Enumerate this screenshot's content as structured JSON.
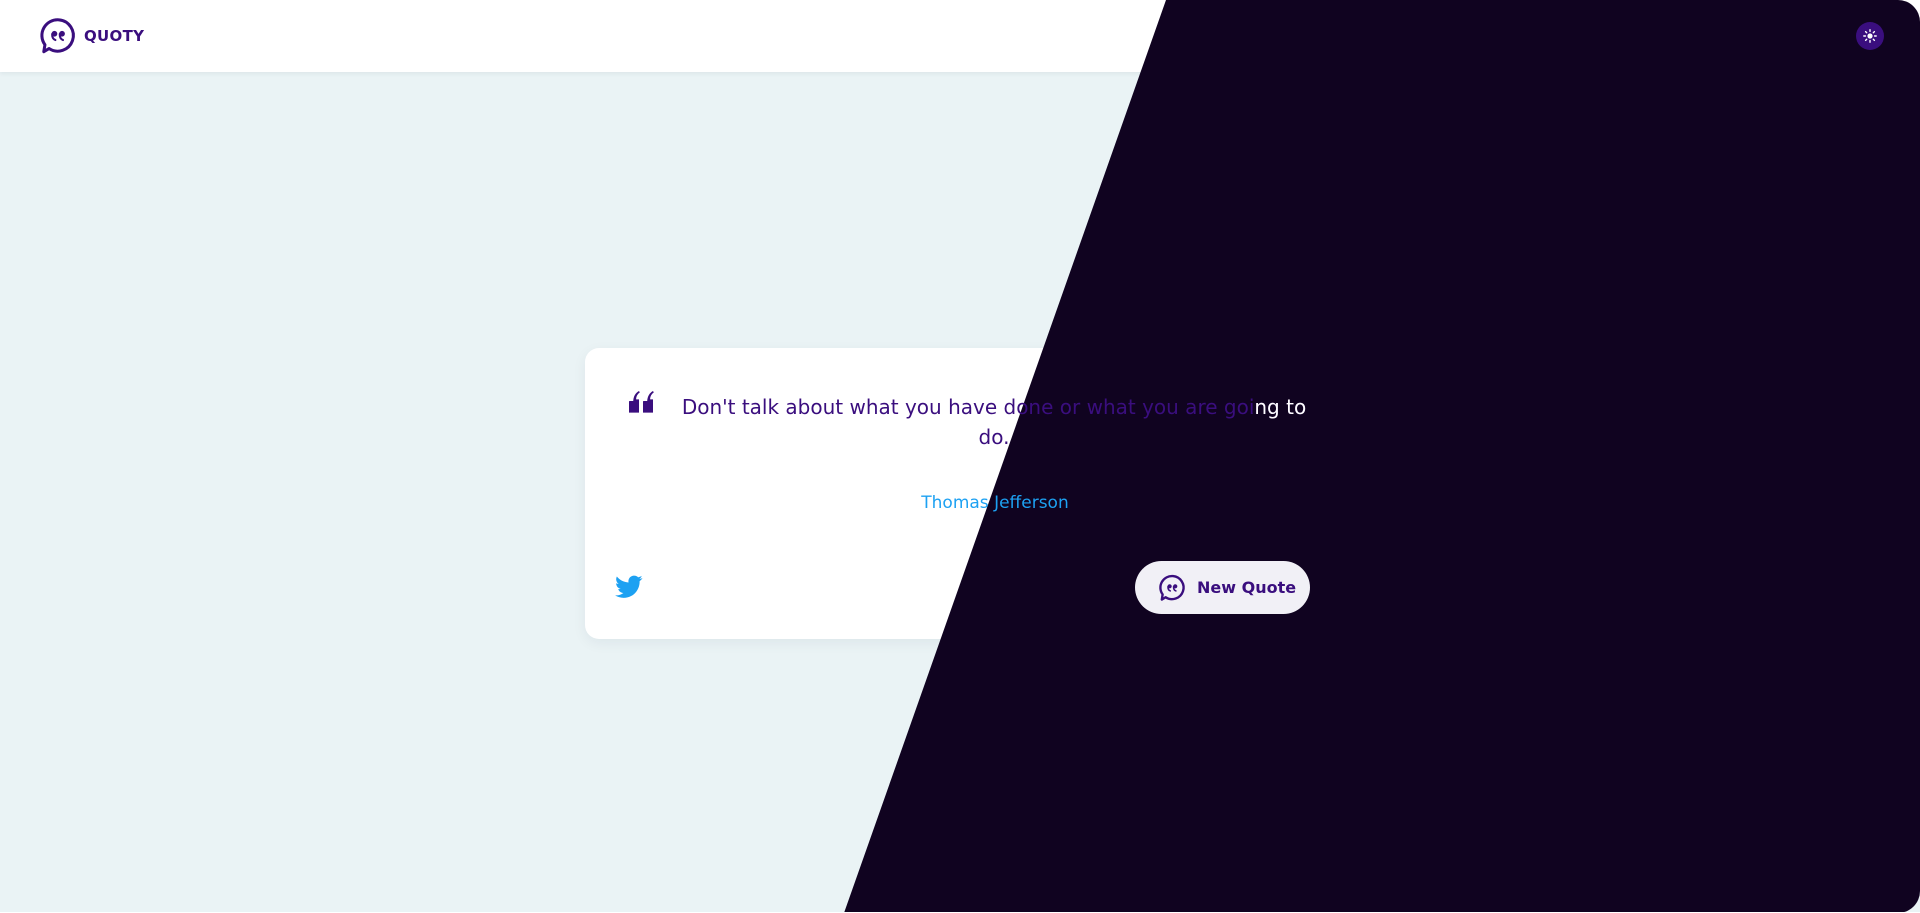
{
  "app": {
    "logo_icon": "chat-bubble-quote-icon",
    "logo_text": "QUOTY"
  },
  "header": {
    "theme_toggle_icon": "sun-icon"
  },
  "quote": {
    "quote_icon": "quote-mark-icon",
    "text": "Don't talk about what you have done or what you are going to do.",
    "author": "Thomas Jefferson"
  },
  "actions": {
    "share_icon": "twitter-icon",
    "new_quote_icon": "chat-bubble-quote-icon",
    "new_quote_label": "New Quote"
  },
  "colors": {
    "primary": "#3a0e7e",
    "accent": "#1da1f2",
    "dark_background": "#100320",
    "light_background": "#eaf3f5",
    "card": "#ffffff",
    "button_background": "#f1f0f6"
  }
}
